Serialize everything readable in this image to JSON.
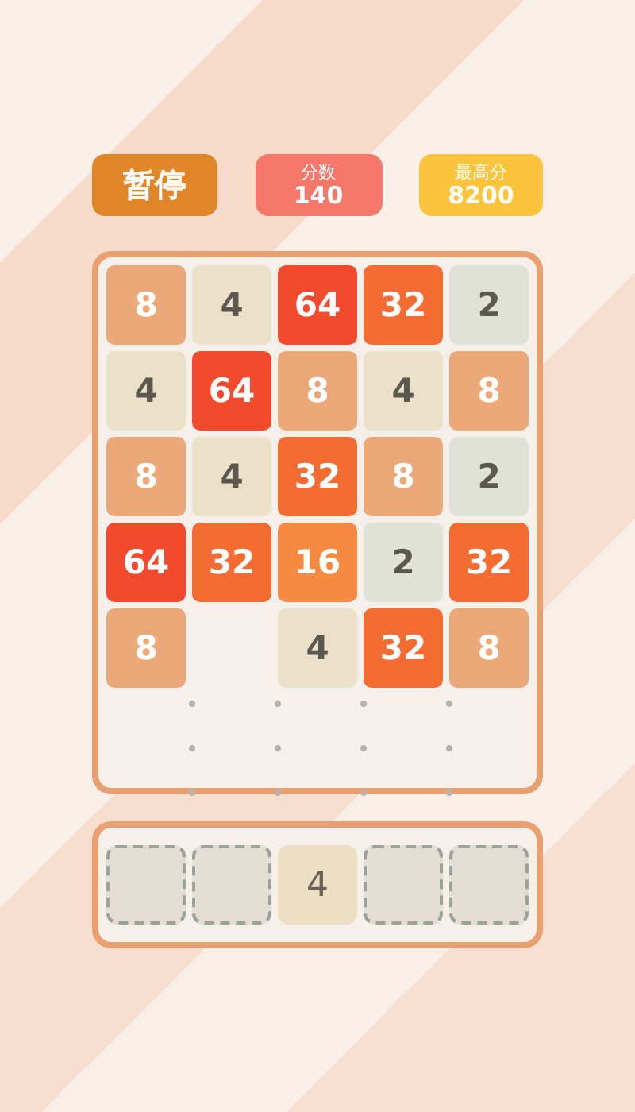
{
  "pause_button": {
    "label": "暂停"
  },
  "score": {
    "label": "分数",
    "value": "140"
  },
  "best": {
    "label": "最高分",
    "value": "8200"
  },
  "board": {
    "rows": [
      [
        {
          "kind": "tile",
          "value": "8",
          "color": "#eba878"
        },
        {
          "kind": "tile",
          "value": "4",
          "color": "#ebe0c8"
        },
        {
          "kind": "tile",
          "value": "64",
          "color": "#f24a2c"
        },
        {
          "kind": "tile",
          "value": "32",
          "color": "#f56c32"
        },
        {
          "kind": "tile",
          "value": "2",
          "color": "#e0e2d8"
        }
      ],
      [
        {
          "kind": "tile",
          "value": "4",
          "color": "#ebe0c8"
        },
        {
          "kind": "tile",
          "value": "64",
          "color": "#f24a2c"
        },
        {
          "kind": "tile",
          "value": "8",
          "color": "#eba878"
        },
        {
          "kind": "tile",
          "value": "4",
          "color": "#ebe0c8"
        },
        {
          "kind": "tile",
          "value": "8",
          "color": "#eba878"
        }
      ],
      [
        {
          "kind": "tile",
          "value": "8",
          "color": "#eba878"
        },
        {
          "kind": "tile",
          "value": "4",
          "color": "#ebe0c8"
        },
        {
          "kind": "tile",
          "value": "32",
          "color": "#f56c32"
        },
        {
          "kind": "tile",
          "value": "8",
          "color": "#eba878"
        },
        {
          "kind": "tile",
          "value": "2",
          "color": "#e0e2d8"
        }
      ],
      [
        {
          "kind": "tile",
          "value": "64",
          "color": "#f24a2c"
        },
        {
          "kind": "tile",
          "value": "32",
          "color": "#f56c32"
        },
        {
          "kind": "tile",
          "value": "16",
          "color": "#f58a40"
        },
        {
          "kind": "tile",
          "value": "2",
          "color": "#e0e2d8"
        },
        {
          "kind": "tile",
          "value": "32",
          "color": "#f56c32"
        }
      ],
      [
        {
          "kind": "tile",
          "value": "8",
          "color": "#eba878"
        },
        {
          "kind": "empty"
        },
        {
          "kind": "tile",
          "value": "4",
          "color": "#ebe0c8"
        },
        {
          "kind": "tile",
          "value": "32",
          "color": "#f56c32"
        },
        {
          "kind": "tile",
          "value": "8",
          "color": "#eba878"
        }
      ]
    ]
  },
  "tray": {
    "slots": [
      {
        "kind": "empty"
      },
      {
        "kind": "empty"
      },
      {
        "kind": "tile",
        "value": "4",
        "color": "#ecdfc4"
      },
      {
        "kind": "empty"
      },
      {
        "kind": "empty"
      }
    ]
  }
}
